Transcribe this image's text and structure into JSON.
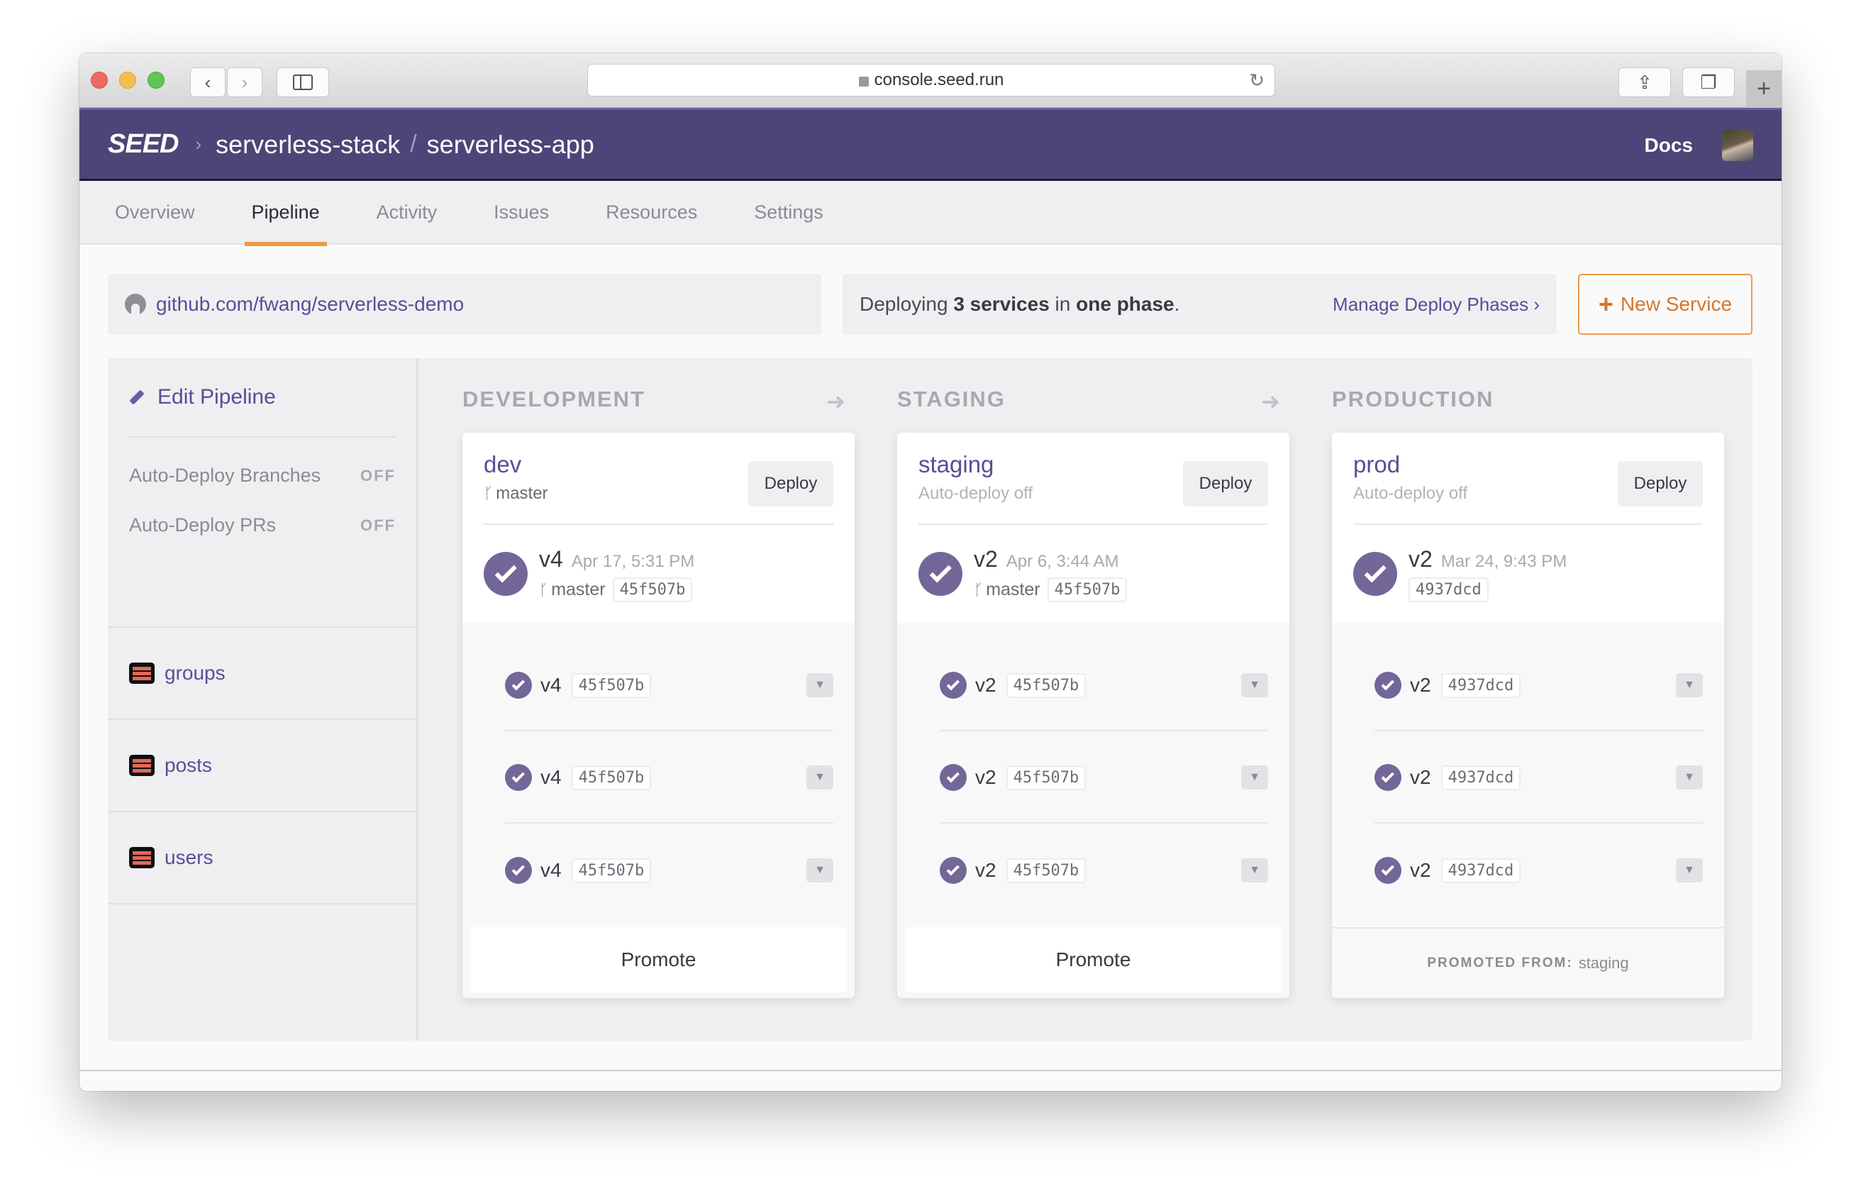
{
  "browser": {
    "url": "console.seed.run",
    "back_icon": "chevron-left-icon",
    "forward_icon": "chevron-right-icon",
    "sidebar_icon": "sidebar-icon",
    "share_icon": "share-icon",
    "tabs_icon": "tabs-icon",
    "new_tab_icon": "plus-icon"
  },
  "header": {
    "logo": "SEED",
    "org": "serverless-stack",
    "app": "serverless-app",
    "docs": "Docs"
  },
  "tabs": [
    {
      "label": "Overview",
      "active": false
    },
    {
      "label": "Pipeline",
      "active": true
    },
    {
      "label": "Activity",
      "active": false
    },
    {
      "label": "Issues",
      "active": false
    },
    {
      "label": "Resources",
      "active": false
    },
    {
      "label": "Settings",
      "active": false
    }
  ],
  "repo": {
    "url": "github.com/fwang/serverless-demo"
  },
  "deploy_info": {
    "prefix": "Deploying ",
    "count": "3 services",
    "middle": " in ",
    "phase": "one phase",
    "suffix": ".",
    "manage": "Manage Deploy Phases ›"
  },
  "new_service": {
    "label": "New Service"
  },
  "sidebar": {
    "edit": "Edit Pipeline",
    "toggles": [
      {
        "label": "Auto-Deploy Branches",
        "value": "OFF"
      },
      {
        "label": "Auto-Deploy PRs",
        "value": "OFF"
      }
    ],
    "services": [
      "groups",
      "posts",
      "users"
    ]
  },
  "stages": [
    {
      "label": "DEVELOPMENT",
      "name": "dev",
      "sub": "master",
      "sub_is_branch": true,
      "deploy": "Deploy",
      "version": "v4",
      "date": "Apr 17, 5:31 PM",
      "branch": "master",
      "sha": "45f507b",
      "services": [
        {
          "version": "v4",
          "sha": "45f507b"
        },
        {
          "version": "v4",
          "sha": "45f507b"
        },
        {
          "version": "v4",
          "sha": "45f507b"
        }
      ],
      "footer": "Promote"
    },
    {
      "label": "STAGING",
      "name": "staging",
      "sub": "Auto-deploy off",
      "sub_is_branch": false,
      "deploy": "Deploy",
      "version": "v2",
      "date": "Apr 6, 3:44 AM",
      "branch": "master",
      "sha": "45f507b",
      "services": [
        {
          "version": "v2",
          "sha": "45f507b"
        },
        {
          "version": "v2",
          "sha": "45f507b"
        },
        {
          "version": "v2",
          "sha": "45f507b"
        }
      ],
      "footer": "Promote"
    },
    {
      "label": "PRODUCTION",
      "name": "prod",
      "sub": "Auto-deploy off",
      "sub_is_branch": false,
      "deploy": "Deploy",
      "version": "v2",
      "date": "Mar 24, 9:43 PM",
      "branch": "",
      "sha": "4937dcd",
      "services": [
        {
          "version": "v2",
          "sha": "4937dcd"
        },
        {
          "version": "v2",
          "sha": "4937dcd"
        },
        {
          "version": "v2",
          "sha": "4937dcd"
        }
      ],
      "promoted_label": "PROMOTED FROM:",
      "promoted_from": "staging"
    }
  ],
  "colors": {
    "brand_purple": "#4f4477",
    "accent_orange": "#ef9a45",
    "link_purple": "#5a4d97",
    "success_check": "#736699"
  }
}
